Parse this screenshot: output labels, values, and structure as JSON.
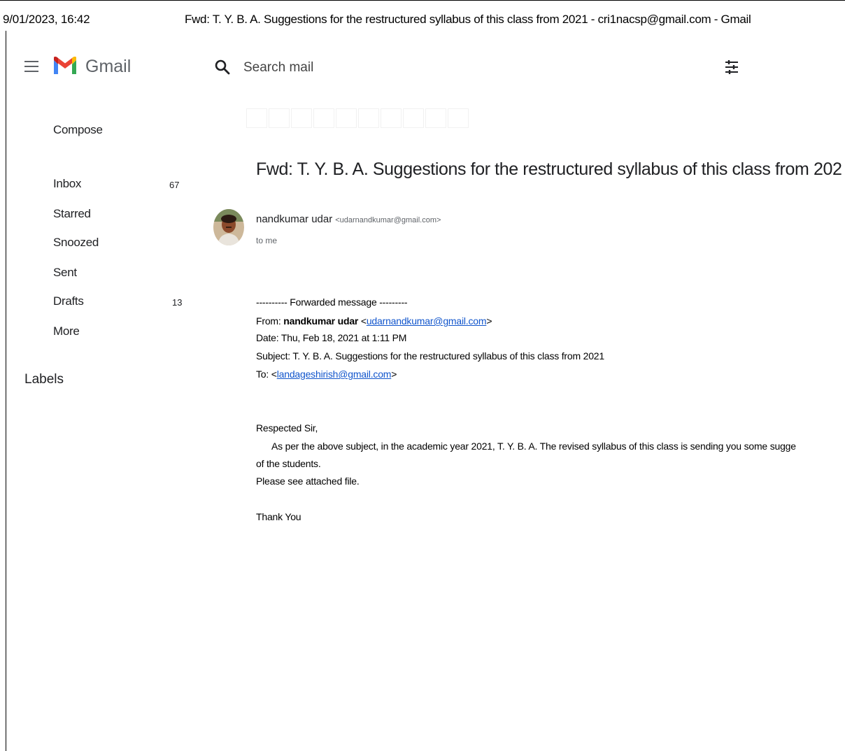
{
  "print_header": {
    "date_time": "9/01/2023, 16:42",
    "title": "Fwd: T. Y. B. A. Suggestions for the restructured syllabus of this class from 2021 - cri1nacsp@gmail.com - Gmail"
  },
  "app": {
    "logo_text": "Gmail",
    "search_placeholder": "Search mail"
  },
  "sidebar": {
    "compose_label": "Compose",
    "items": [
      {
        "label": "Inbox",
        "count": "67"
      },
      {
        "label": "Starred",
        "count": ""
      },
      {
        "label": "Snoozed",
        "count": ""
      },
      {
        "label": "Sent",
        "count": ""
      },
      {
        "label": "Drafts",
        "count": "13"
      },
      {
        "label": "More",
        "count": ""
      }
    ],
    "labels_heading": "Labels"
  },
  "email": {
    "subject": "Fwd: T. Y. B. A. Suggestions for the restructured syllabus of this class from 202",
    "sender_name": "nandkumar udar",
    "sender_email": "<udarnandkumar@gmail.com>",
    "recipient": "to me",
    "forwarded_header": "---------- Forwarded message ---------",
    "from_label": "From:",
    "from_name": "nandkumar udar",
    "from_open": "<",
    "from_email": "udarnandkumar@gmail.com",
    "from_close": ">",
    "date_line": "Date: Thu, Feb 18, 2021 at 1:11 PM",
    "subject_line": "Subject: T. Y. B. A. Suggestions for the restructured syllabus of this class from 2021",
    "to_label": "To: <",
    "to_email": "landageshirish@gmail.com",
    "to_close": ">",
    "greeting": "Respected Sir,",
    "body_line1": "As per the above subject, in the academic year 2021, T.  Y.  B. A. The revised syllabus of this class is sending you some sugge",
    "body_line2": "of the students.",
    "body_line3": "Please see attached file.",
    "closing": "Thank You"
  },
  "colors": {
    "link": "#1155cc",
    "gmail_red": "#ea4335",
    "gmail_blue": "#4285f4",
    "gmail_green": "#34a853",
    "gmail_yellow": "#fbbc04"
  }
}
